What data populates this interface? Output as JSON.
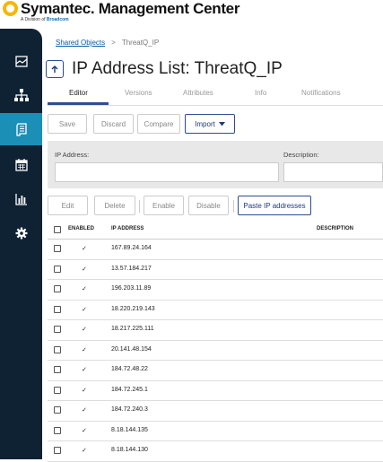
{
  "app": {
    "brand": "Symantec. Management Center",
    "division_prefix": "A Division of",
    "division_name": "Broadcom"
  },
  "breadcrumb": {
    "parent": "Shared Objects",
    "separator": ">",
    "current": "ThreatQ_IP"
  },
  "page": {
    "title": "IP Address List: ThreatQ_IP"
  },
  "tabs": [
    {
      "label": "Editor",
      "active": true
    },
    {
      "label": "Versions",
      "active": false
    },
    {
      "label": "Attributes",
      "active": false
    },
    {
      "label": "Info",
      "active": false
    },
    {
      "label": "Notifications",
      "active": false
    }
  ],
  "toolbar": {
    "save": "Save",
    "discard": "Discard",
    "compare": "Compare",
    "import": "Import"
  },
  "filters": {
    "ip_label": "IP Address:",
    "ip_value": "",
    "desc_label": "Description:",
    "desc_value": ""
  },
  "table_actions": {
    "edit": "Edit",
    "delete": "Delete",
    "enable": "Enable",
    "disable": "Disable",
    "paste": "Paste IP addresses"
  },
  "table": {
    "columns": [
      "ENABLED",
      "IP ADDRESS",
      "DESCRIPTION"
    ],
    "rows": [
      {
        "enabled": "✓",
        "ip": "167.89.24.164",
        "description": ""
      },
      {
        "enabled": "✓",
        "ip": "13.57.184.217",
        "description": ""
      },
      {
        "enabled": "✓",
        "ip": "196.203.11.89",
        "description": ""
      },
      {
        "enabled": "✓",
        "ip": "18.220.219.143",
        "description": ""
      },
      {
        "enabled": "✓",
        "ip": "18.217.225.111",
        "description": ""
      },
      {
        "enabled": "✓",
        "ip": "20.141.48.154",
        "description": ""
      },
      {
        "enabled": "✓",
        "ip": "184.72.48.22",
        "description": ""
      },
      {
        "enabled": "✓",
        "ip": "184.72.245.1",
        "description": ""
      },
      {
        "enabled": "✓",
        "ip": "184.72.240.3",
        "description": ""
      },
      {
        "enabled": "✓",
        "ip": "8.18.144.135",
        "description": ""
      },
      {
        "enabled": "✓",
        "ip": "8.18.144.130",
        "description": ""
      }
    ]
  },
  "colors": {
    "sidebar_bg": "#0f2233",
    "sidebar_active": "#1c8fb6",
    "accent": "#2e4d8f",
    "logo_yellow": "#f5b800",
    "link": "#0a5aa5"
  },
  "sidebar_icons": [
    "dashboard-icon",
    "network-hierarchy-icon",
    "policy-scroll-icon",
    "calendar-icon",
    "reports-chart-icon",
    "settings-gear-icon"
  ]
}
